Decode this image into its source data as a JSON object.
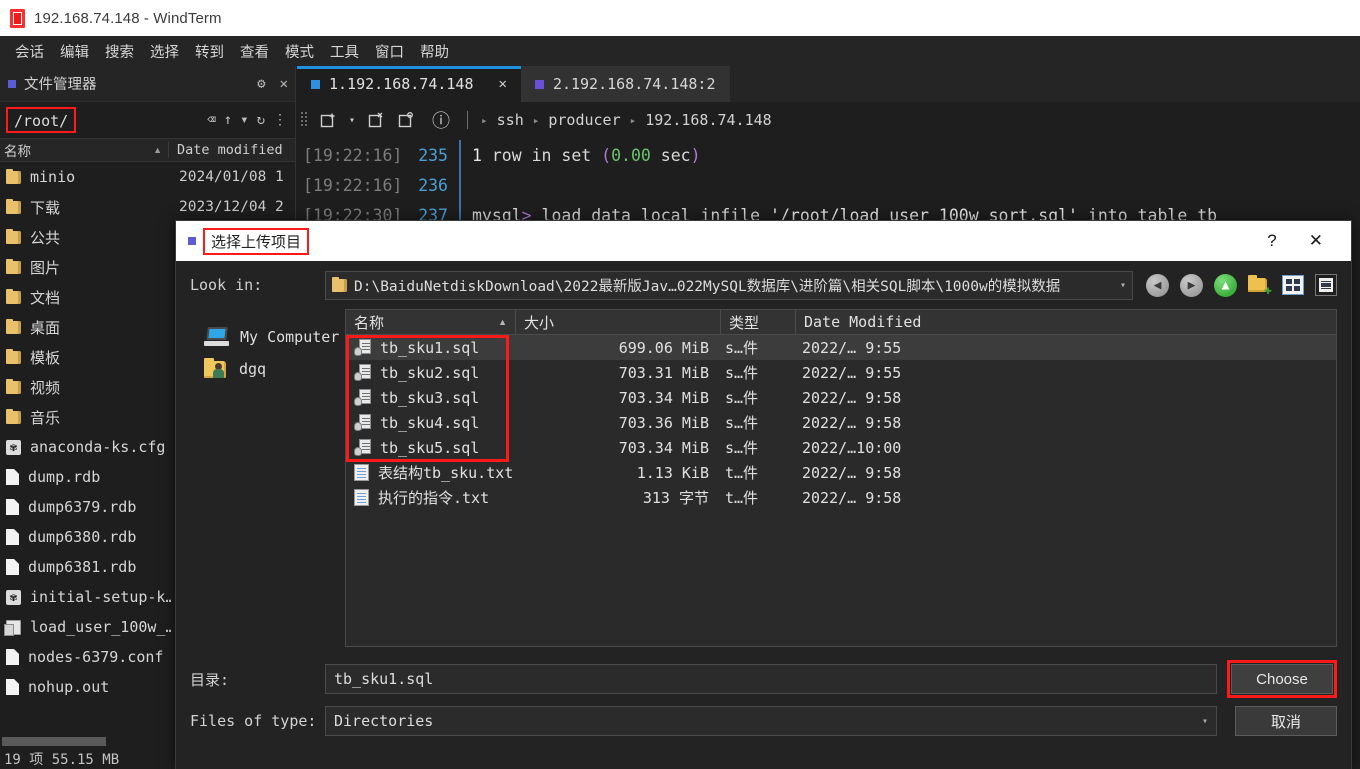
{
  "window": {
    "title": "192.168.74.148 - WindTerm",
    "app_icon": "windterm-icon"
  },
  "menubar": {
    "items": [
      "会话",
      "编辑",
      "搜索",
      "选择",
      "转到",
      "查看",
      "模式",
      "工具",
      "窗口",
      "帮助"
    ]
  },
  "file_manager": {
    "panel_title": "文件管理器",
    "gear_icon": "⚙",
    "close_icon": "✕",
    "path": "/root/",
    "clear_icon": "⌫",
    "up_icon": "↑",
    "dropdown_icon": "▾",
    "refresh_icon": "↻",
    "more_icon": "⋮",
    "columns": [
      "名称",
      "Date modified"
    ],
    "sort_caret": "▲",
    "rows": [
      {
        "name": "minio",
        "icon": "folder-icon",
        "date": "2024/01/08 1"
      },
      {
        "name": "下载",
        "icon": "folder-icon",
        "date": "2023/12/04 2"
      },
      {
        "name": "公共",
        "icon": "folder-icon",
        "date": ""
      },
      {
        "name": "图片",
        "icon": "folder-icon",
        "date": ""
      },
      {
        "name": "文档",
        "icon": "folder-icon",
        "date": ""
      },
      {
        "name": "桌面",
        "icon": "folder-icon",
        "date": ""
      },
      {
        "name": "模板",
        "icon": "folder-icon",
        "date": ""
      },
      {
        "name": "视频",
        "icon": "folder-icon",
        "date": ""
      },
      {
        "name": "音乐",
        "icon": "folder-icon",
        "date": ""
      },
      {
        "name": "anaconda-ks.cfg",
        "icon": "gear-file-icon",
        "date": ""
      },
      {
        "name": "dump.rdb",
        "icon": "file-icon",
        "date": ""
      },
      {
        "name": "dump6379.rdb",
        "icon": "file-icon",
        "date": ""
      },
      {
        "name": "dump6380.rdb",
        "icon": "file-icon",
        "date": ""
      },
      {
        "name": "dump6381.rdb",
        "icon": "file-icon",
        "date": ""
      },
      {
        "name": "initial-setup-k…",
        "icon": "gear-file-icon",
        "date": ""
      },
      {
        "name": "load_user_100w_…",
        "icon": "sql-file-icon",
        "date": ""
      },
      {
        "name": "nodes-6379.conf",
        "icon": "file-icon",
        "date": ""
      },
      {
        "name": "nohup.out",
        "icon": "file-icon",
        "date": ""
      }
    ],
    "status": "19 项 55.15 MB"
  },
  "terminal": {
    "tabs": [
      {
        "label": "1.192.168.74.148",
        "dot_color": "#2f8fe0",
        "active": true,
        "close_icon": "✕"
      },
      {
        "label": "2.192.168.74.148:2",
        "dot_color": "#6b4fd6",
        "active": false
      }
    ],
    "toolbar": {
      "new_tab_icon": "new-tab-icon",
      "dropdown_icon": "▾",
      "close_tab_icon": "close-tab-icon",
      "duplicate_tab_icon": "duplicate-tab-icon",
      "info_icon": "ⓘ"
    },
    "breadcrumb": [
      "ssh",
      "producer",
      "192.168.74.148"
    ],
    "breadcrumb_sep": "▸",
    "lines": [
      {
        "time": "[19:22:16]",
        "num": "235",
        "segments": [
          {
            "text": "1 ",
            "cls": "c-white"
          },
          {
            "text": "row in set ",
            "cls": "txt"
          },
          {
            "text": "(",
            "cls": "c-purple"
          },
          {
            "text": "0.00",
            "cls": "c-green"
          },
          {
            "text": " sec",
            "cls": "txt"
          },
          {
            "text": ")",
            "cls": "c-purple"
          }
        ]
      },
      {
        "time": "[19:22:16]",
        "num": "236",
        "segments": []
      },
      {
        "time": "[19:22:30]",
        "num": "237",
        "segments": [
          {
            "text": "mysql",
            "cls": "txt"
          },
          {
            "text": "> ",
            "cls": "c-purple"
          },
          {
            "text": "load data local infile ",
            "cls": "txt"
          },
          {
            "text": "'/root/load_user_100w_sort.sql'",
            "cls": "c-white"
          },
          {
            "text": " into table tb_",
            "cls": "txt"
          }
        ]
      }
    ]
  },
  "dialog": {
    "title": "选择上传项目",
    "help_icon": "?",
    "close_icon": "✕",
    "look_in_label": "Look in:",
    "look_in_value": "D:\\BaiduNetdiskDownload\\2022最新版Jav…022MySQL数据库\\进阶篇\\相关SQL脚本\\1000w的模拟数据",
    "look_in_dropdown": "▾",
    "nav_icons": [
      "back-icon",
      "forward-icon",
      "up-icon",
      "new-folder-icon",
      "list-view-icon",
      "detail-view-icon"
    ],
    "places": [
      {
        "label": "My Computer",
        "icon": "computer-icon"
      },
      {
        "label": "dgq",
        "icon": "user-folder-icon"
      }
    ],
    "columns": [
      "名称",
      "大小",
      "类型",
      "Date Modified"
    ],
    "sort_caret": "▲",
    "files": [
      {
        "name": "tb_sku1.sql",
        "icon": "sql-file-icon",
        "size": "699.06 MiB",
        "type": "s…件",
        "date": "2022/… 9:55",
        "selected": true
      },
      {
        "name": "tb_sku2.sql",
        "icon": "sql-file-icon",
        "size": "703.31 MiB",
        "type": "s…件",
        "date": "2022/… 9:55",
        "selected": false
      },
      {
        "name": "tb_sku3.sql",
        "icon": "sql-file-icon",
        "size": "703.34 MiB",
        "type": "s…件",
        "date": "2022/… 9:58",
        "selected": false
      },
      {
        "name": "tb_sku4.sql",
        "icon": "sql-file-icon",
        "size": "703.36 MiB",
        "type": "s…件",
        "date": "2022/… 9:58",
        "selected": false
      },
      {
        "name": "tb_sku5.sql",
        "icon": "sql-file-icon",
        "size": "703.34 MiB",
        "type": "s…件",
        "date": "2022/…10:00",
        "selected": false
      },
      {
        "name": "表结构tb_sku.txt",
        "icon": "txt-file-icon",
        "size": "1.13 KiB",
        "type": "t…件",
        "date": "2022/… 9:58",
        "selected": false
      },
      {
        "name": "执行的指令.txt",
        "icon": "txt-file-icon",
        "size": "313 字节",
        "type": "t…件",
        "date": "2022/… 9:58",
        "selected": false
      }
    ],
    "dir_label": "目录:",
    "dir_value": "tb_sku1.sql",
    "filetype_label": "Files of type:",
    "filetype_value": "Directories",
    "filetype_dropdown": "▾",
    "choose_button": "Choose",
    "cancel_button": "取消"
  },
  "colors": {
    "accent_blue": "#1f8fe0",
    "highlight_red": "#ff1a1a",
    "bg_dark": "#1e1e1e",
    "dialog_bg": "#232323"
  }
}
